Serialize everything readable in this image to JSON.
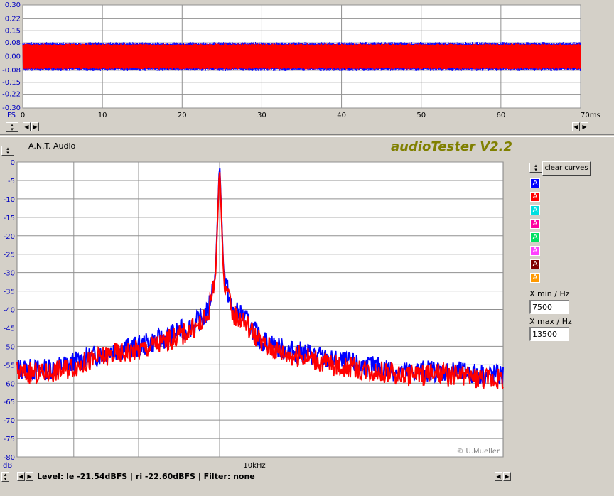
{
  "app": {
    "title": "audioTester V2.2",
    "device": "A.N.T. Audio",
    "copyright": "© U.Mueller"
  },
  "controls": {
    "clear_curves": "clear curves",
    "xmin_label": "X min / Hz",
    "xmin_value": "7500",
    "xmax_label": "X max / Hz",
    "xmax_value": "13500",
    "channel_label": "A",
    "channels": [
      "#0000ff",
      "#ff0000",
      "#00e0e0",
      "#ff00a0",
      "#00e060",
      "#ff40ff",
      "#800000",
      "#ff9900"
    ]
  },
  "status": {
    "text": "Level: le -21.54dBFS | ri -22.60dBFS | Filter: none"
  },
  "chart_data": [
    {
      "type": "line",
      "title": "",
      "ylabel": "FS",
      "xlabel": "ms",
      "ylim": [
        -0.3,
        0.3
      ],
      "xlim": [
        0,
        70
      ],
      "y_ticks": [
        "0.30",
        "0.22",
        "0.15",
        "0.08",
        "0.00",
        "-0.08",
        "-0.15",
        "-0.22",
        "-0.30"
      ],
      "y_tick_values": [
        0.3,
        0.22,
        0.15,
        0.08,
        0,
        -0.08,
        -0.15,
        -0.22,
        -0.3
      ],
      "x_ticks": [
        "0",
        "10",
        "20",
        "30",
        "40",
        "50",
        "60",
        "70ms"
      ],
      "x_tick_values": [
        0,
        10,
        20,
        30,
        40,
        50,
        60,
        70
      ],
      "grid": true,
      "series": [
        {
          "color": "#0000ff",
          "amplitude": 0.085
        },
        {
          "color": "#ff0000",
          "amplitude": 0.075
        }
      ]
    },
    {
      "type": "line",
      "title": "",
      "ylabel": "dB",
      "xlabel": "10kHz",
      "xlim": [
        7500,
        13500
      ],
      "ylim": [
        -80,
        0
      ],
      "y_ticks": [
        "0",
        "-5",
        "-10",
        "-15",
        "-20",
        "-25",
        "-30",
        "-35",
        "-40",
        "-45",
        "-50",
        "-55",
        "-60",
        "-65",
        "-70",
        "-75",
        "-80"
      ],
      "y_tick_values": [
        0,
        -5,
        -10,
        -15,
        -20,
        -25,
        -30,
        -35,
        -40,
        -45,
        -50,
        -55,
        -60,
        -65,
        -70,
        -75,
        -80
      ],
      "grid": true,
      "series": [
        {
          "color": "#0000ff",
          "x": [
            7500,
            7800,
            8100,
            8400,
            8700,
            9000,
            9300,
            9500,
            9700,
            9850,
            9950,
            10000,
            10050,
            10150,
            10300,
            10500,
            10800,
            11100,
            11400,
            11700,
            12000,
            12300,
            12600,
            12900,
            13200,
            13500
          ],
          "y": [
            -56,
            -56.5,
            -55,
            -53,
            -51,
            -50,
            -48,
            -46,
            -44,
            -41,
            -30,
            0,
            -30,
            -40,
            -42,
            -48,
            -51,
            -52,
            -54,
            -55,
            -56,
            -57,
            -56.5,
            -57,
            -57.5,
            -58
          ]
        },
        {
          "color": "#ff0000",
          "x": [
            7500,
            7800,
            8100,
            8400,
            8700,
            9000,
            9300,
            9500,
            9700,
            9850,
            9950,
            10000,
            10050,
            10150,
            10300,
            10500,
            10800,
            11100,
            11400,
            11700,
            12000,
            12300,
            12600,
            12900,
            13200,
            13500
          ],
          "y": [
            -57,
            -57.5,
            -56,
            -54,
            -52,
            -51,
            -49,
            -47,
            -45,
            -42,
            -31,
            -1,
            -31,
            -41,
            -43,
            -49,
            -52,
            -53,
            -55,
            -56,
            -57,
            -58,
            -57.5,
            -58,
            -58.5,
            -59
          ]
        }
      ]
    }
  ]
}
